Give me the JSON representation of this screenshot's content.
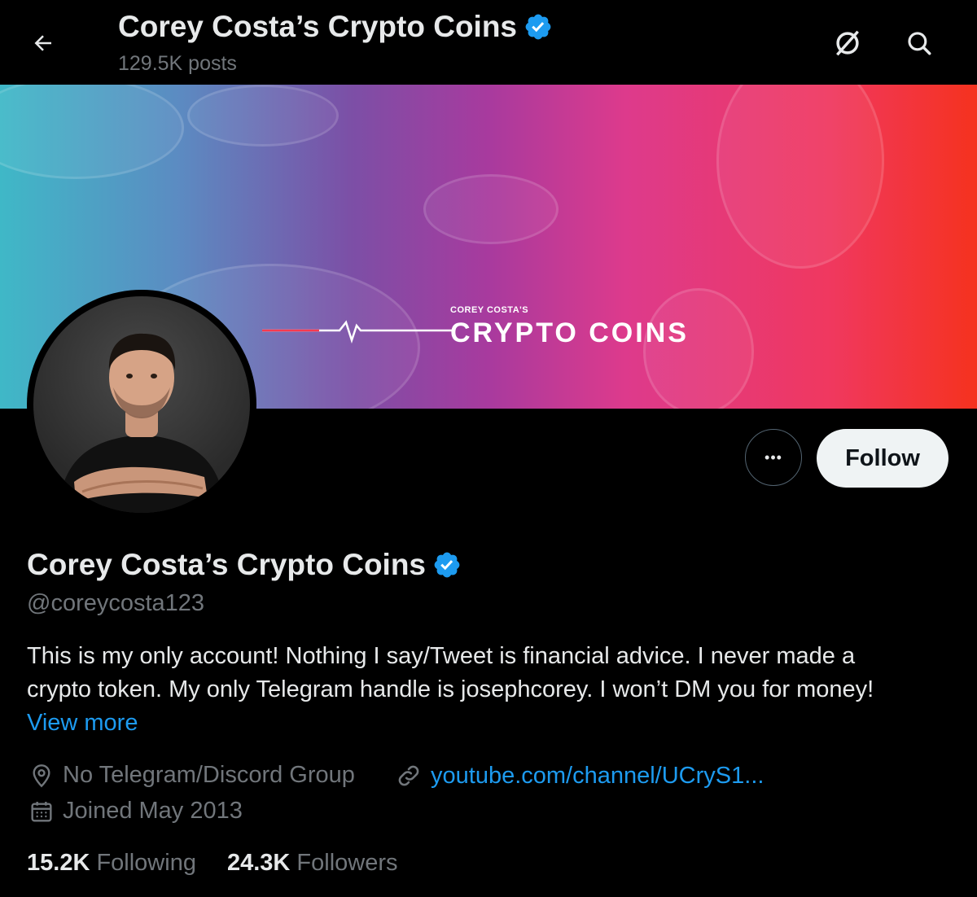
{
  "header": {
    "title": "Corey Costa’s Crypto Coins",
    "posts": "129.5K posts"
  },
  "banner": {
    "small_text": "COREY COSTA'S",
    "big_text": "CRYPTO COINS"
  },
  "profile": {
    "name": "Corey Costa’s Crypto Coins",
    "handle": "@coreycosta123",
    "bio_line1": "This is my only account! Nothing I say/Tweet is financial advice. I never made a",
    "bio_line2": "crypto token. My only Telegram handle is josephcorey. I won’t DM you for money!",
    "view_more": "View more",
    "location": "No Telegram/Discord Group",
    "website": "youtube.com/channel/UCryS1...",
    "joined": "Joined May 2013"
  },
  "actions": {
    "follow_label": "Follow",
    "more_label": "•••"
  },
  "stats": {
    "following_count": "15.2K",
    "following_label": "Following",
    "followers_count": "24.3K",
    "followers_label": "Followers"
  },
  "icons": {
    "back": "arrow-left-icon",
    "grok": "slashed-circle-icon",
    "search": "search-icon",
    "verified": "verified-badge-icon",
    "location": "location-pin-icon",
    "link": "link-icon",
    "calendar": "calendar-icon"
  },
  "colors": {
    "accent": "#1d9bf0",
    "muted": "#71767b",
    "text": "#e7e9ea",
    "background": "#000000"
  }
}
